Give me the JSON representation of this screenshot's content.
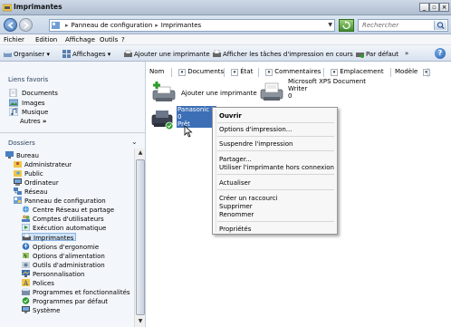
{
  "window": {
    "title": "Imprimantes"
  },
  "address": {
    "crumbs": [
      "Panneau de configuration",
      "Imprimantes"
    ],
    "search_placeholder": "Rechercher"
  },
  "menu": [
    "Fichier",
    "Edition",
    "Affichage",
    "Outils",
    "?"
  ],
  "toolbar": {
    "organize": "Organiser",
    "views": "Affichages",
    "add_printer": "Ajouter une imprimante",
    "show_jobs": "Afficher les tâches d'impression en cours",
    "set_default": "Par défaut",
    "more": "»"
  },
  "favorites": {
    "title": "Liens favoris",
    "items": [
      "Documents",
      "Images",
      "Musique"
    ],
    "more": "Autres"
  },
  "folders": {
    "title": "Dossiers",
    "tree": [
      "Bureau",
      "Administrateur",
      "Public",
      "Ordinateur",
      "Réseau",
      "Panneau de configuration",
      "Centre Réseau et partage",
      "Comptes d'utilisateurs",
      "Exécution automatique",
      "Imprimantes",
      "Options d'ergonomie",
      "Options d'alimentation",
      "Outils d'administration",
      "Personnalisation",
      "Polices",
      "Programmes et fonctionnalités",
      "Programmes par défaut",
      "Système"
    ]
  },
  "columns": [
    "Nom",
    "Documents",
    "État",
    "Commentaires",
    "Emplacement",
    "Modèle"
  ],
  "printers": {
    "add": "Ajouter une imprimante",
    "xps_line1": "Microsoft XPS Document",
    "xps_line2": "Writer",
    "xps_count": "0",
    "panasonic_name": "Panasonic DP-...",
    "panasonic_count": "0",
    "panasonic_status": "Prêt"
  },
  "context_menu": {
    "open": "Ouvrir",
    "print_options": "Options d'impression...",
    "pause": "Suspendre l'impression",
    "share": "Partager...",
    "offline": "Utiliser l'imprimante hors connexion",
    "refresh": "Actualiser",
    "shortcut": "Créer un raccourci",
    "delete": "Supprimer",
    "rename": "Renommer",
    "properties": "Propriétés"
  }
}
